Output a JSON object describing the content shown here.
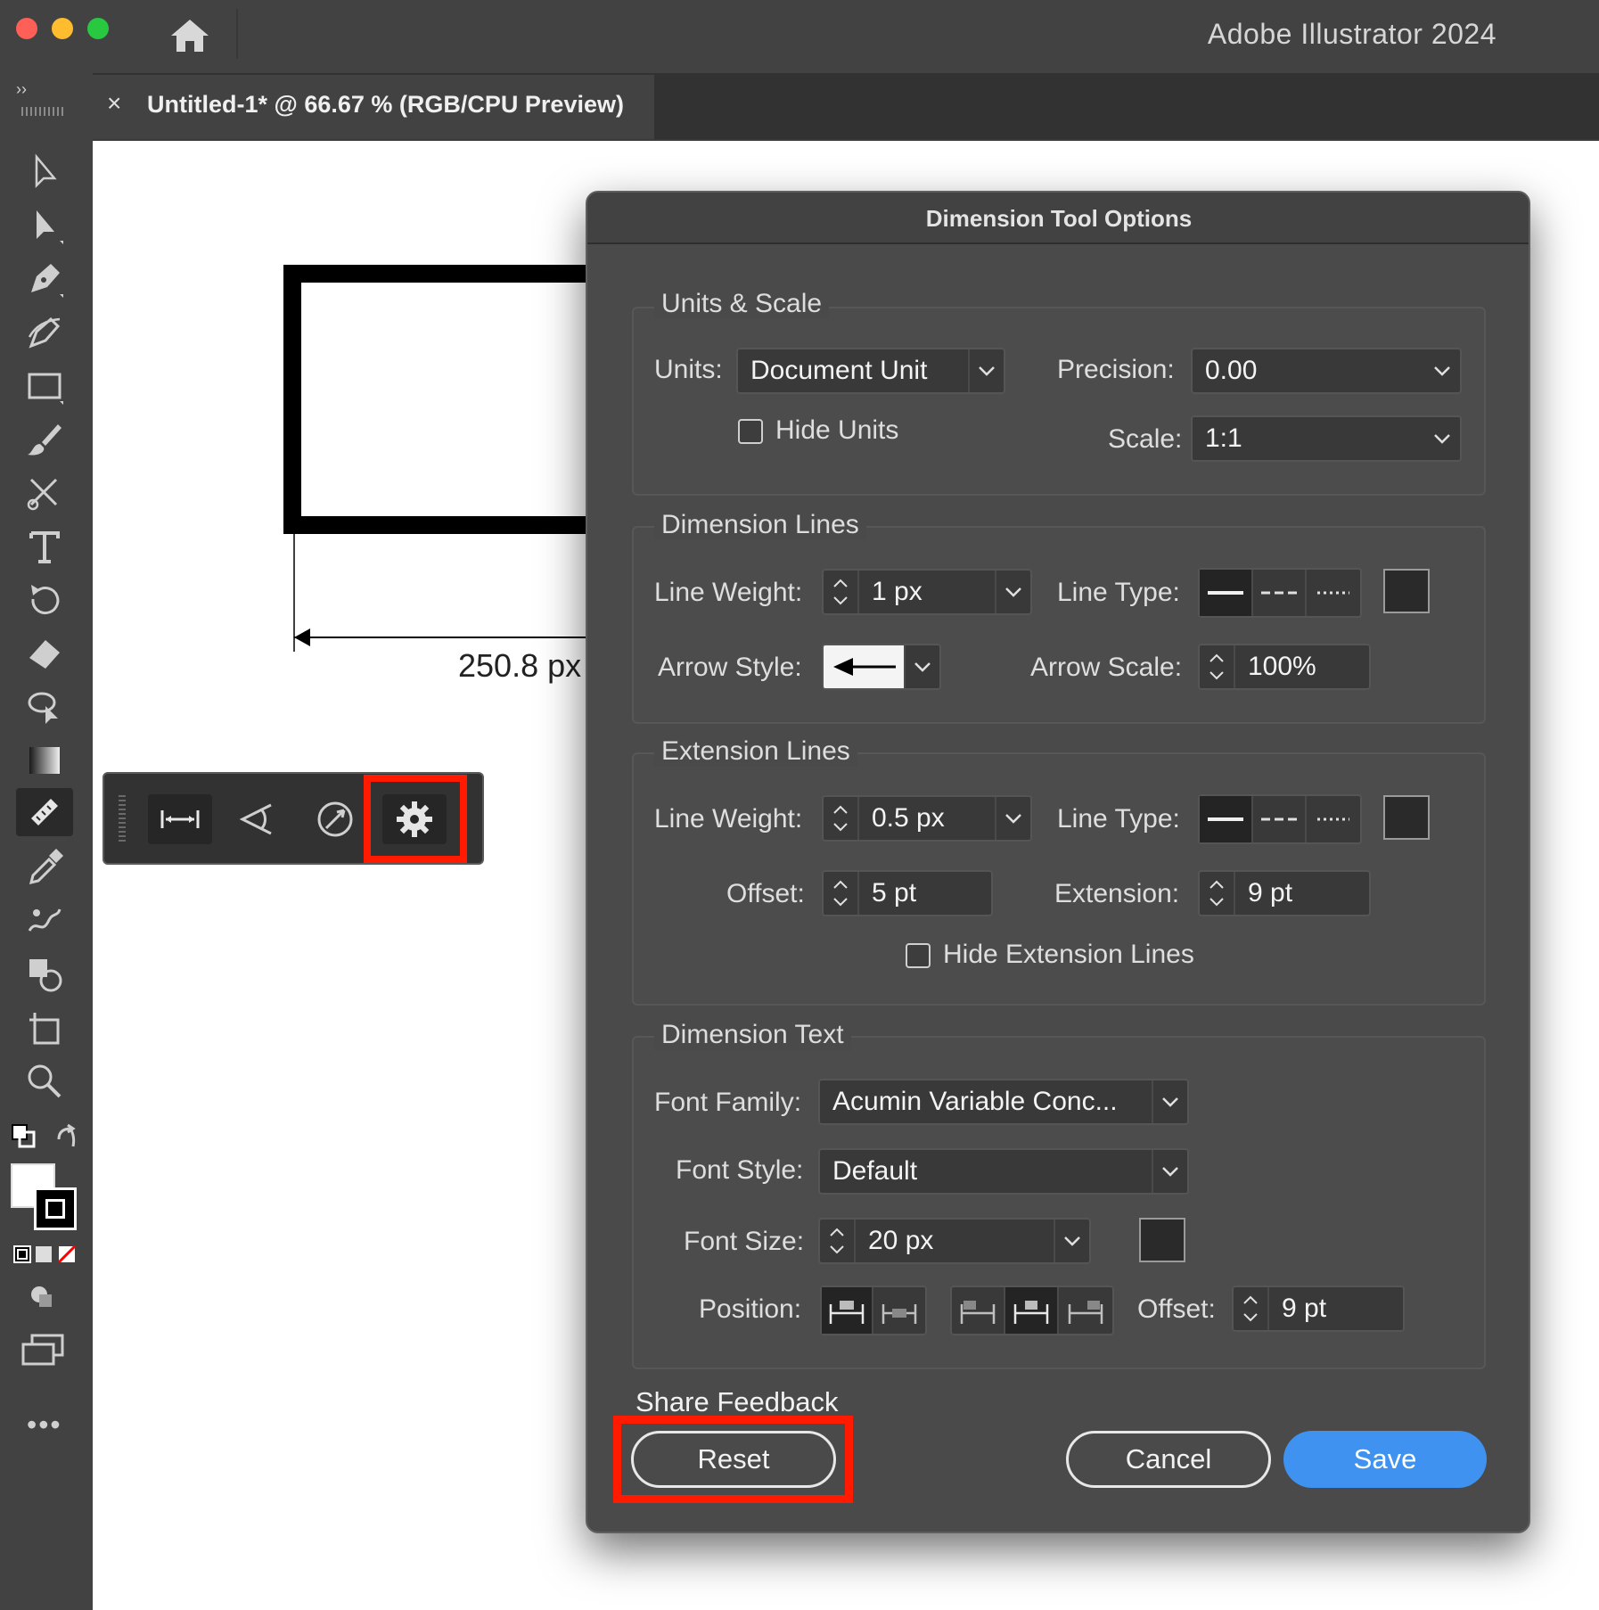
{
  "window": {
    "app_title": "Adobe Illustrator 2024",
    "traffic_colors": {
      "close": "#fe5f57",
      "minimize": "#febc2e",
      "zoom": "#28c840"
    }
  },
  "tab": {
    "close_glyph": "×",
    "title": "Untitled-1* @ 66.67 % (RGB/CPU Preview)"
  },
  "toolbar_icons": [
    "selection-icon",
    "direct-selection-icon",
    "pen-icon",
    "curvature-icon",
    "rectangle-icon",
    "paintbrush-icon",
    "scissors-icon",
    "type-icon",
    "rotate-icon",
    "eraser-icon",
    "lasso-icon",
    "gradient-icon",
    "dimension-icon",
    "eyedropper-icon",
    "puppet-warp-icon",
    "shape-builder-icon",
    "artboard-icon",
    "zoom-icon"
  ],
  "canvas": {
    "dimension_label": "250.8 px"
  },
  "float_bar": {
    "icons": [
      "linear-dimension-icon",
      "angular-dimension-icon",
      "radial-dimension-icon",
      "settings-gear-icon"
    ]
  },
  "dialog": {
    "title": "Dimension Tool Options",
    "units_scale": {
      "title": "Units & Scale",
      "units_label": "Units:",
      "units_value": "Document Unit",
      "precision_label": "Precision:",
      "precision_value": "0.00",
      "hide_units_label": "Hide Units",
      "scale_label": "Scale:",
      "scale_value": "1:1"
    },
    "dimension_lines": {
      "title": "Dimension Lines",
      "line_weight_label": "Line Weight:",
      "line_weight_value": "1 px",
      "line_type_label": "Line Type:",
      "arrow_style_label": "Arrow Style:",
      "arrow_scale_label": "Arrow Scale:",
      "arrow_scale_value": "100%",
      "color": "#2a2a2a"
    },
    "extension_lines": {
      "title": "Extension Lines",
      "line_weight_label": "Line Weight:",
      "line_weight_value": "0.5 px",
      "line_type_label": "Line Type:",
      "offset_label": "Offset:",
      "offset_value": "5 pt",
      "extension_label": "Extension:",
      "extension_value": "9 pt",
      "hide_ext_label": "Hide Extension Lines"
    },
    "dimension_text": {
      "title": "Dimension Text",
      "font_family_label": "Font Family:",
      "font_family_value": "Acumin Variable Conc...",
      "font_style_label": "Font Style:",
      "font_style_value": "Default",
      "font_size_label": "Font Size:",
      "font_size_value": "20 px",
      "position_label": "Position:",
      "offset_label": "Offset:",
      "offset_value": "9 pt"
    },
    "share_feedback": "Share Feedback",
    "reset_label": "Reset",
    "cancel_label": "Cancel",
    "save_label": "Save"
  },
  "highlight_color": "#ff1a00",
  "accent_color": "#3f92f0"
}
